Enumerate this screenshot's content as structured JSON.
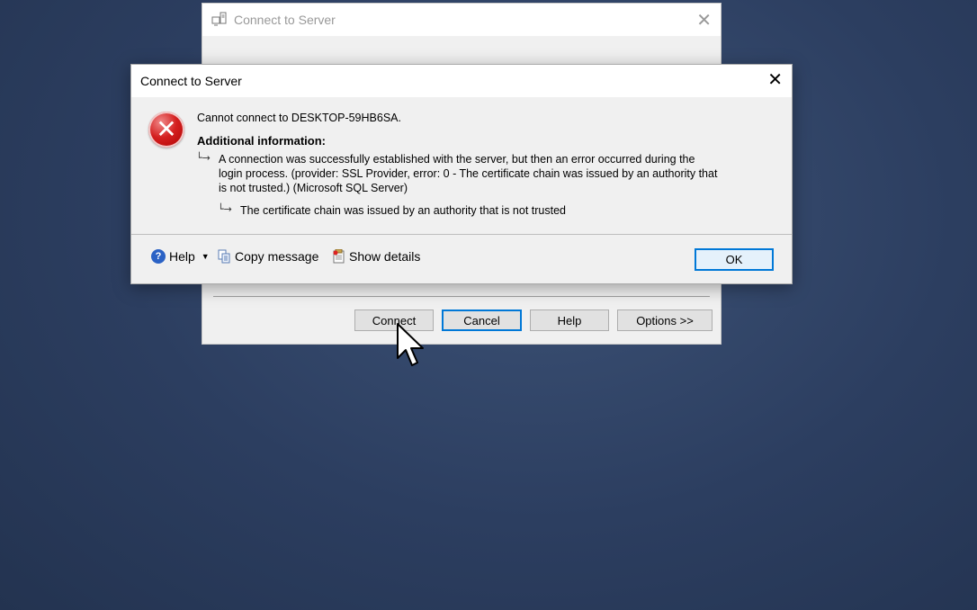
{
  "background_window": {
    "title": "Connect to Server",
    "buttons": {
      "connect": "Connect",
      "cancel": "Cancel",
      "help": "Help",
      "options": "Options >>"
    }
  },
  "error_dialog": {
    "title": "Connect to Server",
    "main_message": "Cannot connect to DESKTOP-59HB6SA.",
    "additional_heading": "Additional information:",
    "detail_line1": "A connection was successfully established with the server, but then an error occurred during the",
    "detail_line2": "login process. (provider: SSL Provider, error: 0 - The certificate chain was issued by an authority that",
    "detail_line3": "is not trusted.) (Microsoft SQL Server)",
    "inner_detail": "The certificate chain was issued by an authority that is not trusted",
    "footer": {
      "help_label": "Help",
      "copy_label": "Copy message",
      "details_label": "Show details",
      "ok_label": "OK"
    }
  },
  "icons": {
    "error": "error-icon",
    "close": "close-icon",
    "help": "help-icon",
    "copy": "copy-icon",
    "details": "details-icon"
  }
}
